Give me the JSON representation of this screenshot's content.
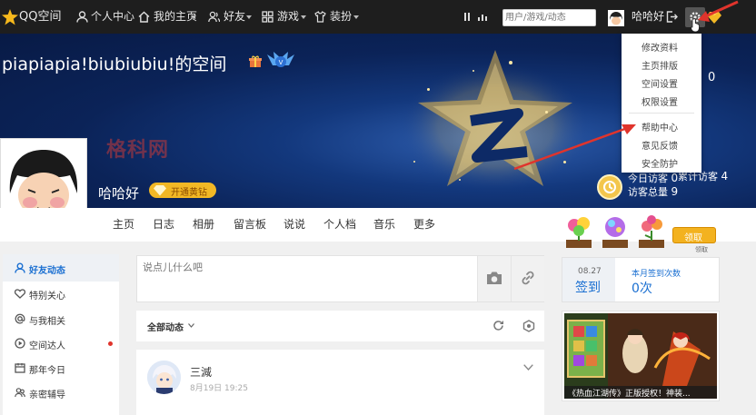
{
  "topbar": {
    "logo": "QQ空间",
    "nav": [
      "个人中心",
      "我的主页",
      "好友",
      "游戏",
      "装扮"
    ],
    "search_placeholder": "用户/游戏/动态",
    "username": "哈哈好"
  },
  "dropdown_menu": [
    "修改资料",
    "主页排版",
    "空间设置",
    "权限设置",
    "帮助中心",
    "意见反馈",
    "安全防护"
  ],
  "banner": {
    "space_title": "piapiapia!biubiubiu!的空间",
    "watermark": "格科网",
    "nickname": "哈哈好",
    "vip_button": "开通黄钻",
    "count_partial": "0",
    "stats": {
      "today_label": "今日访客",
      "today_value": "0",
      "total_label": "累计访客",
      "total_value": "4",
      "visitors_label": "访客总量",
      "visitors_value": "9"
    }
  },
  "tabs": [
    "主页",
    "日志",
    "相册",
    "留言板",
    "说说",
    "个人档",
    "音乐",
    "更多"
  ],
  "sidebar": [
    "好友动态",
    "特别关心",
    "与我相关",
    "空间达人",
    "那年今日",
    "亲密辅导"
  ],
  "composer": {
    "placeholder": "说点儿什么吧"
  },
  "feed": {
    "filter_label": "全部动态",
    "post_author": "三減",
    "post_time": "8月19日 19:25"
  },
  "right": {
    "sign_button": "领取",
    "sign_label": "领取",
    "date": "08.27",
    "checkin": "签到",
    "monthly_label": "本月签到次数",
    "monthly_value": "0次",
    "ad_text": "《热血江湖传》正版授权！神装..."
  },
  "colors": {
    "topbar": "#1e1e1e",
    "banner": "#0b2358",
    "accent_blue": "#1a6fd1",
    "vip_gold": "#f2b825",
    "arrow_red": "#e0342c"
  }
}
